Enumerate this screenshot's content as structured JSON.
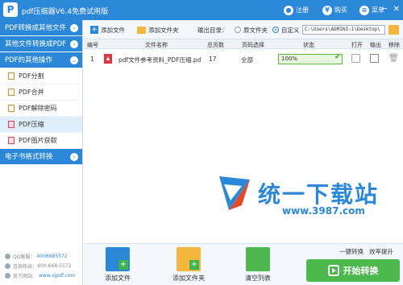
{
  "titlebar": {
    "app_title": "pdf压缩器V6.4免费试用版",
    "logo_letter": "P",
    "register": "注册",
    "buy": "购买",
    "menu": "菜单",
    "minimize": "─",
    "close": "✕"
  },
  "sidebar": {
    "categories": [
      {
        "label": "PDF转换成其他文件"
      },
      {
        "label": "其他文件转换成PDF"
      },
      {
        "label": "PDF的其他操作"
      },
      {
        "label": "电子书格式转换"
      }
    ],
    "items": [
      {
        "label": "PDF分割"
      },
      {
        "label": "PDF合并"
      },
      {
        "label": "PDF解除密码"
      },
      {
        "label": "PDF压缩"
      },
      {
        "label": "PDF图片获取"
      }
    ],
    "qq_label": "QQ客服：",
    "qq_value": "4006685572",
    "phone_label": "咨询热线：",
    "phone_value": "400-668-5572",
    "web_label": "官方网站：",
    "web_value": "www.xjpdf.com"
  },
  "toolbar": {
    "add_file": "添加文件",
    "add_folder": "添加文件夹",
    "output_label": "输出目录：",
    "opt_original": "原文件夹",
    "opt_custom": "自定义",
    "path": "C:\\Users\\ADMINI~1\\Desktop\\"
  },
  "table": {
    "headers": [
      "编号",
      "文件名称",
      "总页数",
      "页码选择",
      "状态",
      "打开",
      "输出",
      "移除"
    ],
    "rows": [
      {
        "num": "1",
        "name": "pdf文件参考资料_PDF压缩.pd",
        "pages": "17",
        "range": "全部",
        "status": "100%"
      }
    ],
    "progress": 1.0
  },
  "watermark": {
    "text": "统一下载站",
    "url": "www.3987.com"
  },
  "bottom": {
    "add_file": "添加文件",
    "add_folder": "添加文件夹",
    "clear": "清空列表",
    "mode_one": "一键转换",
    "mode_eff": "效率提升",
    "start": "开始转换"
  }
}
